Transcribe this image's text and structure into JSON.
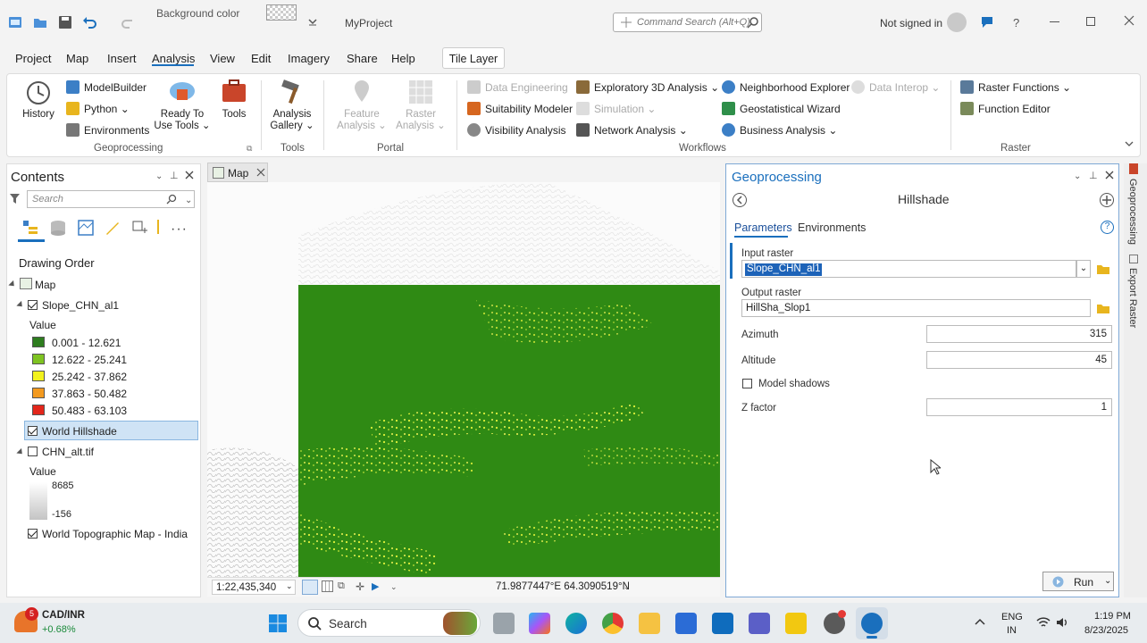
{
  "titlebar": {
    "background_color_label": "Background color",
    "project_name": "MyProject",
    "command_search_placeholder": "Command Search (Alt+Q)",
    "signin": "Not signed in",
    "help": "?"
  },
  "menu": {
    "tabs": [
      "Project",
      "Map",
      "Insert",
      "Analysis",
      "View",
      "Edit",
      "Imagery",
      "Share",
      "Help"
    ],
    "active": "Analysis",
    "contextual_tab": "Tile Layer"
  },
  "ribbon": {
    "geoprocessing": {
      "label": "Geoprocessing",
      "history": "History",
      "modelbuilder": "ModelBuilder",
      "python": "Python",
      "environments": "Environments",
      "ready_to_use_1": "Ready To",
      "ready_to_use_2": "Use Tools",
      "tools": "Tools"
    },
    "tools_group": {
      "label": "Tools",
      "analysis_gallery_1": "Analysis",
      "analysis_gallery_2": "Gallery"
    },
    "portal": {
      "label": "Portal",
      "feature_1": "Feature",
      "feature_2": "Analysis",
      "raster_1": "Raster",
      "raster_2": "Analysis"
    },
    "workflows": {
      "label": "Workflows",
      "data_engineering": "Data Engineering",
      "suitability_modeler": "Suitability Modeler",
      "visibility_analysis": "Visibility Analysis",
      "exploratory_3d": "Exploratory 3D Analysis",
      "simulation": "Simulation",
      "network_analysis": "Network Analysis",
      "neighborhood_explorer": "Neighborhood Explorer",
      "geostatistical_wizard": "Geostatistical Wizard",
      "business_analysis": "Business Analysis",
      "data_interop": "Data Interop"
    },
    "raster": {
      "label": "Raster",
      "raster_functions": "Raster Functions",
      "function_editor": "Function Editor"
    }
  },
  "contents": {
    "title": "Contents",
    "search_placeholder": "Search",
    "drawing_order": "Drawing Order",
    "map": "Map",
    "layer1": "Slope_CHN_al1",
    "value_label": "Value",
    "legend": [
      {
        "label": "0.001 - 12.621",
        "color": "#2e7d1f"
      },
      {
        "label": "12.622 - 25.241",
        "color": "#7ec321"
      },
      {
        "label": "25.242 - 37.862",
        "color": "#f2f21e"
      },
      {
        "label": "37.863 - 50.482",
        "color": "#f39a1f"
      },
      {
        "label": "50.483 - 63.103",
        "color": "#e3261b"
      }
    ],
    "layer2": "World Hillshade",
    "layer3": "CHN_alt.tif",
    "alt_high": "8685",
    "alt_low": "-156",
    "layer4": "World Topographic Map - India"
  },
  "map": {
    "tab": "Map",
    "scale": "1:22,435,340",
    "coords": "71.9877447°E 64.3090519°N"
  },
  "geoprocessing": {
    "title": "Geoprocessing",
    "tool": "Hillshade",
    "tab_parameters": "Parameters",
    "tab_environments": "Environments",
    "input_raster_label": "Input raster",
    "input_raster": "Slope_CHN_al1",
    "output_raster_label": "Output raster",
    "output_raster": "HillSha_Slop1",
    "azimuth_label": "Azimuth",
    "azimuth": "315",
    "altitude_label": "Altitude",
    "altitude": "45",
    "model_shadows": "Model shadows",
    "z_factor_label": "Z factor",
    "z_factor": "1",
    "run": "Run"
  },
  "rail": {
    "geoprocessing": "Geoprocessing",
    "export_raster": "Export Raster"
  },
  "taskbar": {
    "ticker": "CAD/INR",
    "change": "+0.68%",
    "badge": "5",
    "search": "Search",
    "lang1": "ENG",
    "lang2": "IN",
    "time": "1:19 PM",
    "date": "8/23/2025"
  }
}
